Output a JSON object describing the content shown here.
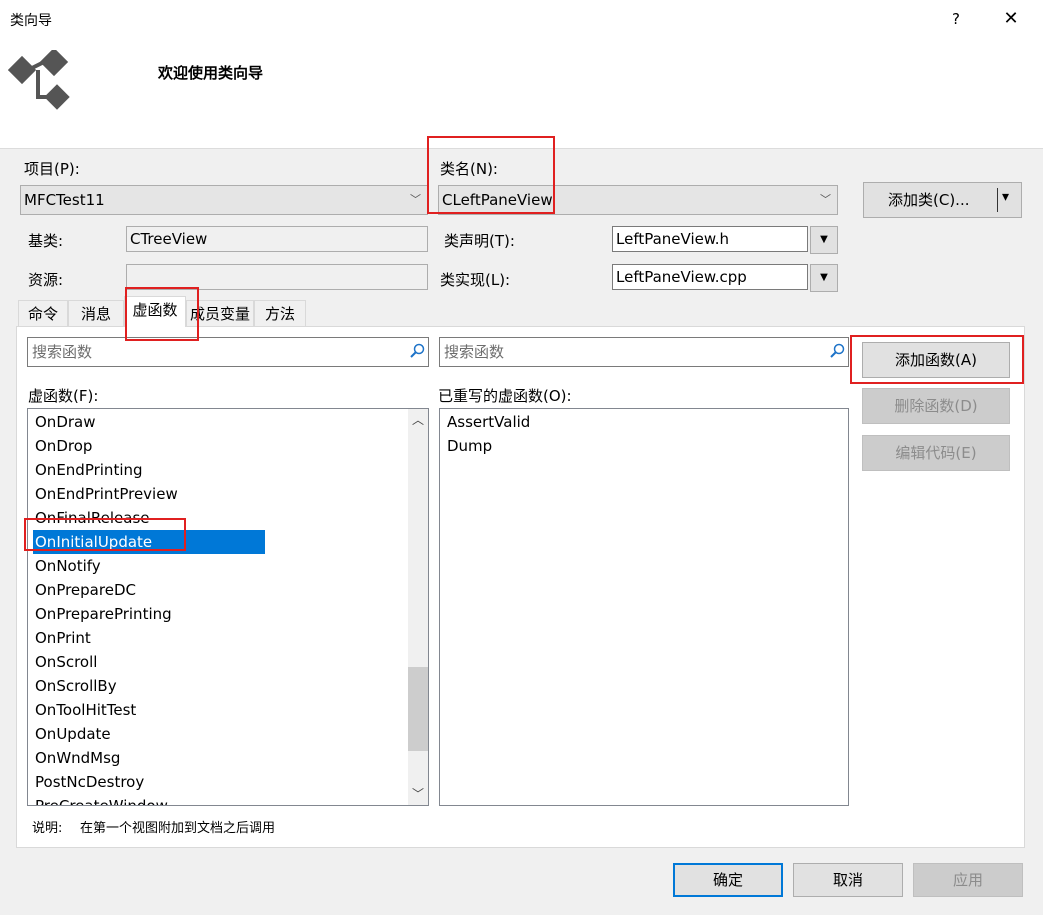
{
  "window": {
    "title": "类向导",
    "help": "?",
    "close": "✕",
    "welcome": "欢迎使用类向导"
  },
  "project": {
    "label": "项目(P):",
    "value": "MFCTest11"
  },
  "classname": {
    "label": "类名(N):",
    "value": "CLeftPaneView"
  },
  "add_class": {
    "label": "添加类(C)...",
    "arrow": "▾"
  },
  "base_class": {
    "label": "基类:",
    "value": "CTreeView"
  },
  "resource": {
    "label": "资源:",
    "value": ""
  },
  "class_decl": {
    "label": "类声明(T):",
    "value": "LeftPaneView.h"
  },
  "class_impl": {
    "label": "类实现(L):",
    "value": "LeftPaneView.cpp"
  },
  "tabs": [
    "命令",
    "消息",
    "虚函数",
    "成员变量",
    "方法"
  ],
  "search_left": {
    "placeholder": "搜索函数"
  },
  "search_right": {
    "placeholder": "搜索函数"
  },
  "virtual_functions": {
    "label": "虚函数(F):",
    "items": [
      "OnDraw",
      "OnDrop",
      "OnEndPrinting",
      "OnEndPrintPreview",
      "OnFinalRelease",
      "OnInitialUpdate",
      "OnNotify",
      "OnPrepareDC",
      "OnPreparePrinting",
      "OnPrint",
      "OnScroll",
      "OnScrollBy",
      "OnToolHitTest",
      "OnUpdate",
      "OnWndMsg",
      "PostNcDestroy",
      "PreCreateWindow"
    ],
    "selected": "OnInitialUpdate"
  },
  "overridden": {
    "label": "已重写的虚函数(O):",
    "items": [
      "AssertValid",
      "Dump"
    ]
  },
  "buttons": {
    "add_function": "添加函数(A)",
    "delete_function": "删除函数(D)",
    "edit_code": "编辑代码(E)",
    "ok": "确定",
    "cancel": "取消",
    "apply": "应用"
  },
  "description": {
    "label": "说明:",
    "text": "在第一个视图附加到文档之后调用"
  },
  "colors": {
    "highlight": "#0078d7",
    "annotation": "#e02020"
  }
}
